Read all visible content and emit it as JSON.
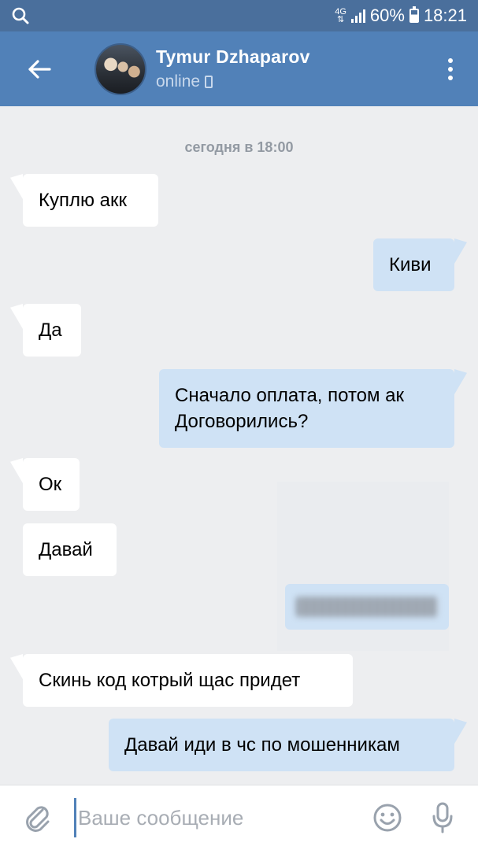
{
  "status_bar": {
    "network": "4G",
    "battery": "60%",
    "time": "18:21"
  },
  "header": {
    "contact_name": "Tymur Dzhaparov",
    "status": "online"
  },
  "chat": {
    "date_label": "сегодня в 18:00",
    "messages": [
      {
        "direction": "in",
        "text": "Куплю акк"
      },
      {
        "direction": "out",
        "text": "Киви"
      },
      {
        "direction": "in",
        "text": "Да"
      },
      {
        "direction": "out",
        "line1": "Сначало оплата, потом ак",
        "line2": "Договорились?"
      },
      {
        "direction": "in",
        "text": "Ок"
      },
      {
        "direction": "in",
        "text": "Давай"
      },
      {
        "direction": "in",
        "text": "Скинь код котрый щас придет"
      },
      {
        "direction": "out",
        "text": "Давай иди в чс по мошенникам"
      }
    ]
  },
  "composer": {
    "placeholder": "Ваше сообщение"
  },
  "colors": {
    "header": "#5181b8",
    "status_bar": "#4a6f9c",
    "background": "#edeef0",
    "incoming_bubble": "#ffffff",
    "outgoing_bubble": "#cfe2f5"
  },
  "icons": [
    "search-icon",
    "back-arrow-icon",
    "menu-icon",
    "phone-icon",
    "attach-icon",
    "emoji-icon",
    "mic-icon"
  ]
}
